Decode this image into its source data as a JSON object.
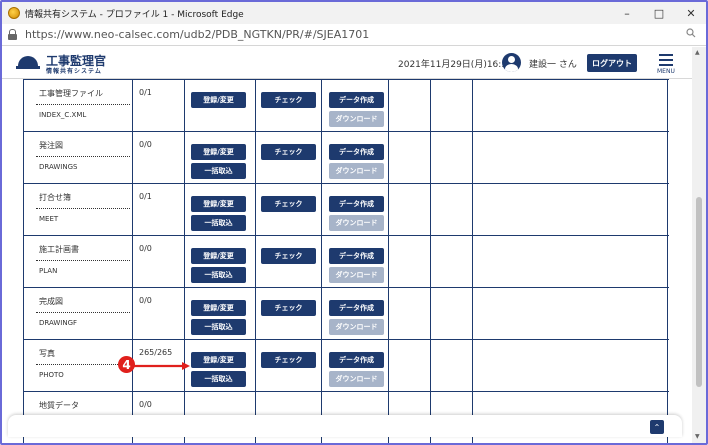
{
  "browser": {
    "window_title": "情報共有システム - プロファイル 1 - Microsoft Edge",
    "url": "https://www.neo-calsec.com/udb2/PDB_NGTKN/PR/#/SJEA1701",
    "minimize_glyph": "–",
    "maximize_glyph": "□",
    "close_glyph": "✕"
  },
  "header": {
    "logo_title": "工事監理官",
    "logo_subtitle": "情報共有システム",
    "datetime": "2021年11月29日(月)16:30",
    "username": "建設一 さん",
    "logout_label": "ログアウト",
    "menu_label": "MENU"
  },
  "buttons": {
    "register": "登録/変更",
    "bulk": "一括取込",
    "check": "チェック",
    "create": "データ作成",
    "download": "ダウンロード"
  },
  "rows": [
    {
      "name_jp": "",
      "name_en": "",
      "count": ""
    },
    {
      "name_jp": "工事管理ファイル",
      "name_en": "INDEX_C.XML",
      "count": "0/1"
    },
    {
      "name_jp": "発注図",
      "name_en": "DRAWINGS",
      "count": "0/0"
    },
    {
      "name_jp": "打合せ簿",
      "name_en": "MEET",
      "count": "0/1"
    },
    {
      "name_jp": "施工計画書",
      "name_en": "PLAN",
      "count": "0/0"
    },
    {
      "name_jp": "完成図",
      "name_en": "DRAWINGF",
      "count": "0/0"
    },
    {
      "name_jp": "写真",
      "name_en": "PHOTO",
      "count": "265/265"
    },
    {
      "name_jp": "地質データ",
      "name_en": "",
      "count": "0/0"
    }
  ],
  "annotation": {
    "number": "4"
  },
  "totop_glyph": "⌃",
  "colors": {
    "navy": "#1e3a6e",
    "disabled": "#a7b4c9",
    "annotation": "#e0201c"
  }
}
